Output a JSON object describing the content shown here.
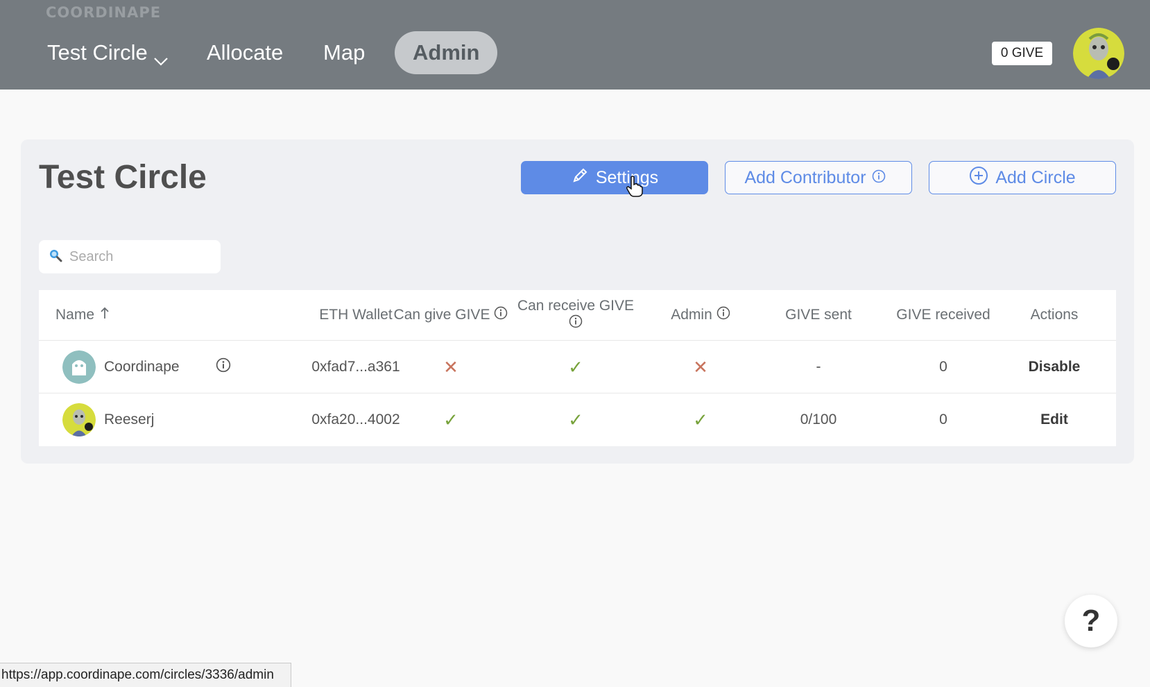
{
  "header": {
    "logo": "COORDINAPE",
    "nav": {
      "circle": "Test Circle",
      "allocate": "Allocate",
      "map": "Map",
      "admin": "Admin"
    },
    "give_badge": "0 GIVE"
  },
  "main": {
    "title": "Test Circle",
    "buttons": {
      "settings": "Settings",
      "add_contributor": "Add Contributor",
      "add_circle": "Add Circle"
    },
    "search": {
      "placeholder": "Search"
    }
  },
  "table": {
    "headers": {
      "name": "Name",
      "wallet": "ETH Wallet",
      "can_give": "Can give GIVE",
      "can_receive": "Can receive GIVE",
      "admin": "Admin",
      "give_sent": "GIVE sent",
      "give_received": "GIVE received",
      "actions": "Actions"
    },
    "rows": [
      {
        "name": "Coordinape",
        "wallet": "0xfad7...a361",
        "can_give": "✕",
        "can_receive": "✓",
        "admin": "✕",
        "give_sent": "-",
        "give_received": "0",
        "action": "Disable"
      },
      {
        "name": "Reeserj",
        "wallet": "0xfa20...4002",
        "can_give": "✓",
        "can_receive": "✓",
        "admin": "✓",
        "give_sent": "0/100",
        "give_received": "0",
        "action": "Edit"
      }
    ]
  },
  "help": {
    "label": "?"
  },
  "status_bar": {
    "url": "https://app.coordinape.com/circles/3336/admin"
  },
  "colors": {
    "topbar": "#757b80",
    "primary": "#5e8be6",
    "x_mark": "#c8745d",
    "check_mark": "#78a33c"
  }
}
